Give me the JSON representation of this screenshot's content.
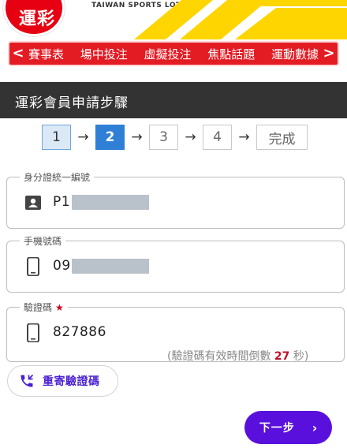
{
  "header": {
    "logo_text": "運彩",
    "tagline": "TAIWAN SPORTS LOTTERY"
  },
  "nav": {
    "left_arrow": "<",
    "right_arrow": ">",
    "items": [
      "賽事表",
      "場中投注",
      "虛擬投注",
      "焦點話題",
      "運動數據"
    ]
  },
  "page": {
    "title": "運彩會員申請步驟"
  },
  "steps": {
    "items": [
      "1",
      "2",
      "3",
      "4",
      "完成"
    ],
    "arrow": "→",
    "active_index": 2
  },
  "form": {
    "id_field": {
      "label": "身分證統一編號",
      "value": "P1",
      "icon": "id-card-icon"
    },
    "phone_field": {
      "label": "手機號碼",
      "value": "09",
      "icon": "mobile-phone-icon"
    },
    "code_field": {
      "label": "驗證碼",
      "required_mark": "★",
      "value": "827886",
      "icon": "mobile-phone-icon"
    },
    "countdown": {
      "prefix": "(驗證碼有效時間倒數 ",
      "seconds": "27",
      "suffix": " 秒)"
    }
  },
  "actions": {
    "resend_label": "重寄驗證碼",
    "resend_icon": "phone-callback-icon",
    "next_label": "下一步",
    "next_icon": "chevron-right-icon"
  },
  "colors": {
    "brand_red": "#e31b23",
    "title_bar": "#333333",
    "active_step": "#2f7fd6",
    "primary_purple": "#5a10dc",
    "countdown_red": "#c0102a"
  }
}
